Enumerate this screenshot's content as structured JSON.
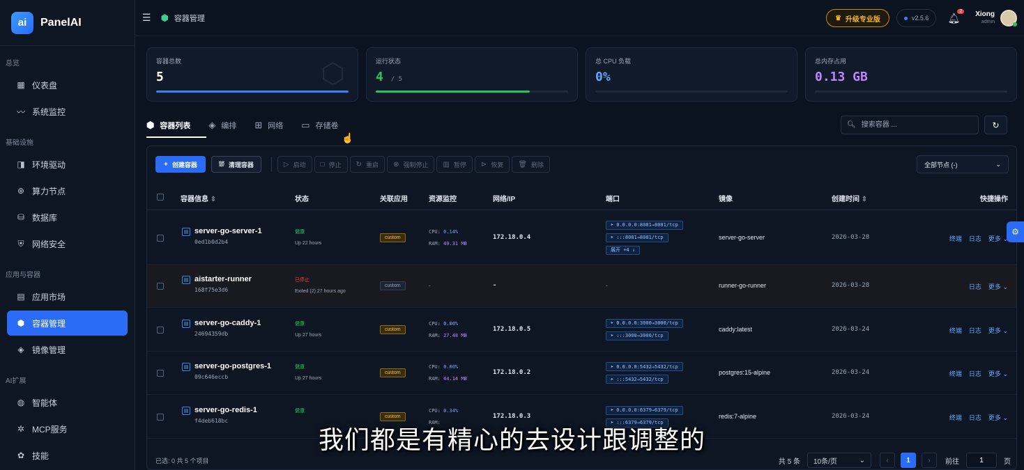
{
  "app": {
    "name": "PanelAI",
    "logo_text": "ai"
  },
  "sidebar": {
    "groups": [
      {
        "label": "总览",
        "items": [
          {
            "label": "仪表盘",
            "icon": "grid-icon"
          },
          {
            "label": "系统监控",
            "icon": "chart-line-icon"
          }
        ]
      },
      {
        "label": "基础设施",
        "items": [
          {
            "label": "环境驱动",
            "icon": "driver-icon"
          },
          {
            "label": "算力节点",
            "icon": "cpu-icon"
          },
          {
            "label": "数据库",
            "icon": "database-icon"
          },
          {
            "label": "网络安全",
            "icon": "shield-icon"
          }
        ]
      },
      {
        "label": "应用与容器",
        "items": [
          {
            "label": "应用市场",
            "icon": "store-icon"
          },
          {
            "label": "容器管理",
            "icon": "box-icon",
            "active": true
          },
          {
            "label": "镜像管理",
            "icon": "layers-icon"
          }
        ]
      },
      {
        "label": "AI扩展",
        "items": [
          {
            "label": "智能体",
            "icon": "agent-icon"
          },
          {
            "label": "MCP服务",
            "icon": "mcp-icon"
          },
          {
            "label": "技能",
            "icon": "skill-icon"
          }
        ]
      }
    ]
  },
  "header": {
    "breadcrumb": "容器管理",
    "pro_button": "升级专业版",
    "version": "v2.5.6",
    "notification_count": "2",
    "user_name": "Xiong",
    "user_role": "admin"
  },
  "stats": [
    {
      "label": "容器总数",
      "value": "5",
      "sub": "",
      "color": "#ffffff",
      "bar_color": "#3b82f6",
      "progress": 1.0
    },
    {
      "label": "运行状态",
      "value": "4",
      "sub": "/ 5",
      "color": "#22c55e",
      "bar_color": "#22c55e",
      "progress": 0.8
    },
    {
      "label": "总 CPU 负载",
      "value": "0%",
      "sub": "",
      "color": "#60a5fa",
      "bar_color": "#3b82f6",
      "progress": 0.0
    },
    {
      "label": "总内存占用",
      "value": "0.13 GB",
      "sub": "",
      "color": "#c084fc",
      "bar_color": "#c084fc",
      "progress": 0.0
    }
  ],
  "tabs": [
    {
      "label": "容器列表",
      "icon": "cube-icon",
      "active": true
    },
    {
      "label": "编排",
      "icon": "layers-icon"
    },
    {
      "label": "网络",
      "icon": "network-icon"
    },
    {
      "label": "存储卷",
      "icon": "disk-icon"
    }
  ],
  "search": {
    "placeholder": "搜索容器 ..."
  },
  "toolbar": {
    "create": "创建容器",
    "clean": "清理容器",
    "start": "启动",
    "stop": "停止",
    "restart": "重启",
    "force_stop": "强制停止",
    "pause": "暂停",
    "resume": "恢复",
    "delete": "删除",
    "node_select": "全部节点 (-)"
  },
  "table": {
    "headers": {
      "info": "容器信息",
      "status": "状态",
      "app": "关联应用",
      "resource": "资源监控",
      "network": "网络/IP",
      "ports": "端口",
      "image": "镜像",
      "created": "创建时间",
      "actions": "快捷操作"
    },
    "rows": [
      {
        "name": "server-go-server-1",
        "id": "0ed1b0d2b4",
        "status": "健康",
        "status_sub": "Up 22 hours",
        "running": true,
        "app": "custom",
        "cpu": "0.14%",
        "ram": "49.31 MB",
        "ip": "172.18.0.4",
        "ports": [
          "0.0.0.0:8081→8081/tcp",
          ":::8081→8081/tcp"
        ],
        "ports_more": "展开 +4 ↓",
        "image": "server-go-server",
        "created": "2026-03-28",
        "actions": [
          "终端",
          "日志",
          "更多"
        ]
      },
      {
        "name": "aistarter-runner",
        "id": "168f75e3d6",
        "status": "已停止",
        "status_sub": "Exited (2) 27 hours ago",
        "running": false,
        "app": "custom",
        "cpu": "",
        "ram": "",
        "resource_placeholder": "-",
        "ip": "-",
        "ports": [],
        "ports_placeholder": "-",
        "image": "runner-go-runner",
        "created": "2026-03-28",
        "actions": [
          "日志",
          "更多"
        ]
      },
      {
        "name": "server-go-caddy-1",
        "id": "24694359db",
        "status": "健康",
        "status_sub": "Up 27 hours",
        "running": true,
        "app": "custom",
        "cpu": "0.00%",
        "ram": "27.48 MB",
        "ip": "172.18.0.5",
        "ports": [
          "0.0.0.0:3000→3000/tcp",
          ":::3000→3000/tcp"
        ],
        "image": "caddy:latest",
        "created": "2026-03-24",
        "actions": [
          "终端",
          "日志",
          "更多"
        ]
      },
      {
        "name": "server-go-postgres-1",
        "id": "09c646eccb",
        "status": "健康",
        "status_sub": "Up 27 hours",
        "running": true,
        "app": "custom",
        "cpu": "0.00%",
        "ram": "44.14 MB",
        "ip": "172.18.0.2",
        "ports": [
          "0.0.0.0:5432→5432/tcp",
          ":::5432→5432/tcp"
        ],
        "image": "postgres:15-alpine",
        "created": "2026-03-24",
        "actions": [
          "终端",
          "日志",
          "更多"
        ]
      },
      {
        "name": "server-go-redis-1",
        "id": "f4deb618bc",
        "status": "健康",
        "status_sub": "",
        "running": true,
        "app": "custom",
        "cpu": "0.34%",
        "ram": "",
        "ip": "172.18.0.3",
        "ports": [
          "0.0.0.0:6379→6379/tcp",
          ":::6379→6379/tcp"
        ],
        "image": "redis:7-alpine",
        "created": "2026-03-24",
        "actions": [
          "终端",
          "日志",
          "更多"
        ]
      }
    ]
  },
  "footer": {
    "selected": "已选: 0  共 5 个项目",
    "total": "共 5 条",
    "page_size": "10条/页",
    "current_page": "1",
    "goto_label": "前往",
    "goto_value": "1",
    "page_unit": "页"
  },
  "subtitle": "我们都是有精心的去设计跟调整的"
}
